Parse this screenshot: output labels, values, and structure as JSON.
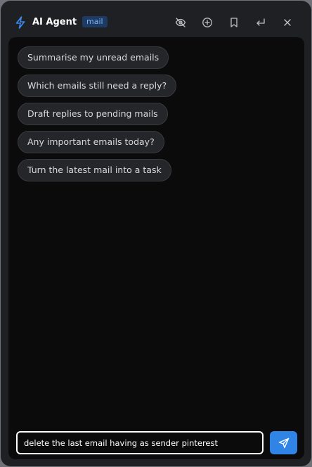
{
  "header": {
    "title": "AI Agent",
    "badge": "mail",
    "icons": [
      "bolt-icon",
      "eye-off-icon",
      "plus-circle-icon",
      "bookmark-icon",
      "enter-icon",
      "close-icon"
    ],
    "accent_color": "#2f84e5"
  },
  "suggestions": [
    "Summarise my unread emails",
    "Which emails still need a reply?",
    "Draft replies to pending mails",
    "Any important emails today?",
    "Turn the latest mail into a task"
  ],
  "composer": {
    "value": "delete the last email having as sender pinterest",
    "send_icon": "send-icon"
  }
}
